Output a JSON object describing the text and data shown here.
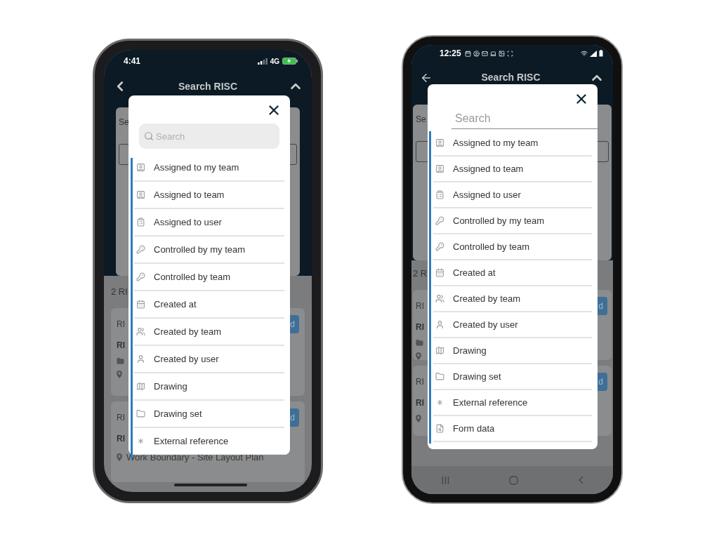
{
  "phones": [
    {
      "kind": "iphone",
      "status_bar": {
        "time": "4:41",
        "network": "4G"
      },
      "header": {
        "title": "Search RISC"
      },
      "background": {
        "filter_label": "Se",
        "results_label": "2 RI",
        "cards": [
          {
            "title": "RI",
            "subtitle": "RI",
            "button": "d"
          },
          {
            "title": "RI",
            "subtitle": "RI",
            "button": "d",
            "location": "Work Boundary - Site Layout Plan"
          }
        ]
      },
      "picker": {
        "search_placeholder": "Search",
        "items": [
          {
            "label": "Assigned to my team"
          },
          {
            "label": "Assigned to team"
          },
          {
            "label": "Assigned to user"
          },
          {
            "label": "Controlled by my team"
          },
          {
            "label": "Controlled by team"
          },
          {
            "label": "Created at"
          },
          {
            "label": "Created by team"
          },
          {
            "label": "Created by user"
          },
          {
            "label": "Drawing"
          },
          {
            "label": "Drawing set"
          },
          {
            "label": "External reference"
          }
        ]
      }
    },
    {
      "kind": "android",
      "status_bar": {
        "time": "12:25"
      },
      "header": {
        "title": "Search RISC"
      },
      "background": {
        "filter_label": "Se",
        "results_label": "2 R",
        "cards": [
          {
            "title": "RI",
            "subtitle": "RI",
            "button": "d"
          },
          {
            "title": "RI",
            "subtitle": "RI",
            "button": "d"
          }
        ]
      },
      "picker": {
        "search_placeholder": "Search",
        "items": [
          {
            "label": "Assigned to my team"
          },
          {
            "label": "Assigned to team"
          },
          {
            "label": "Assigned to user"
          },
          {
            "label": "Controlled by my team"
          },
          {
            "label": "Controlled by team"
          },
          {
            "label": "Created at"
          },
          {
            "label": "Created by team"
          },
          {
            "label": "Created by user"
          },
          {
            "label": "Drawing"
          },
          {
            "label": "Drawing set"
          },
          {
            "label": "External reference"
          },
          {
            "label": "Form data"
          }
        ]
      }
    }
  ]
}
